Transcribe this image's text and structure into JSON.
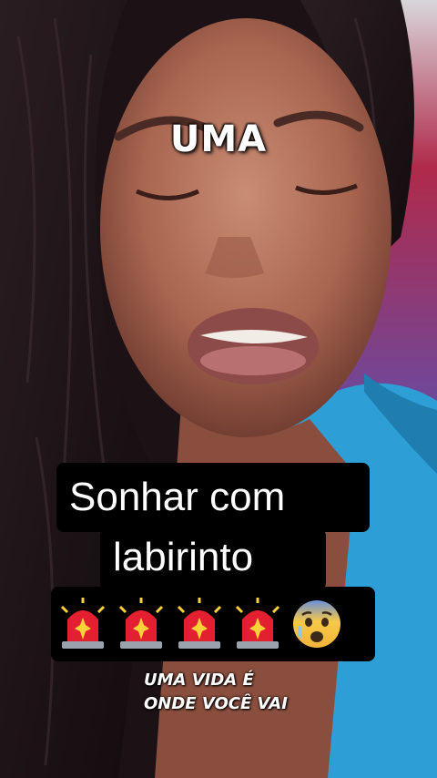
{
  "captions": {
    "top": "UMA",
    "title_line1": "Sonhar com",
    "title_line2": "labirinto",
    "bottom_line1": "UMA VIDA É",
    "bottom_line2": "ONDE VOCÊ VAI"
  },
  "emojis": [
    "police-siren-icon",
    "police-siren-icon",
    "police-siren-icon",
    "police-siren-icon",
    "anxious-face-icon"
  ],
  "colors": {
    "caption_bg": "#000000",
    "caption_text": "#ffffff",
    "shirt": "#2e9fd6"
  }
}
